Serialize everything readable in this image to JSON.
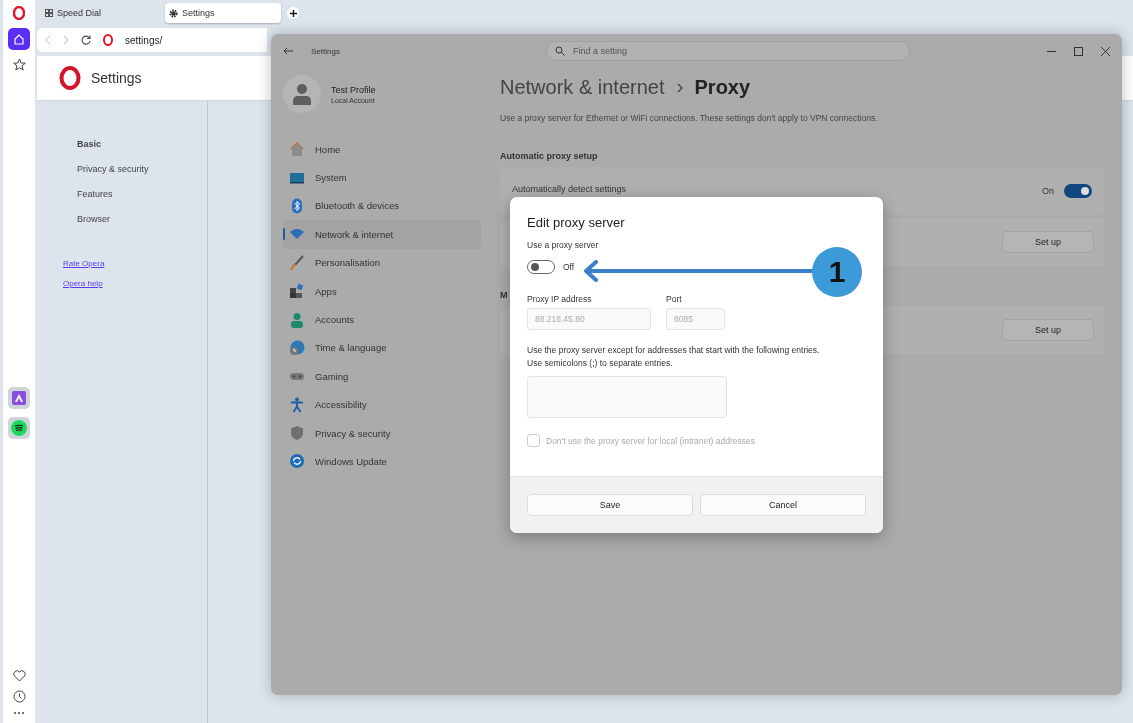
{
  "browser": {
    "tabs": [
      {
        "label": "Speed Dial",
        "selected": false
      },
      {
        "label": "Settings",
        "selected": true
      }
    ],
    "address": "settings/",
    "page_title": "Settings",
    "nav": [
      {
        "label": "Basic",
        "selected": true
      },
      {
        "label": "Privacy & security",
        "selected": false
      },
      {
        "label": "Features",
        "selected": false
      },
      {
        "label": "Browser",
        "selected": false
      }
    ],
    "links": [
      "Rate Opera",
      "Opera help"
    ]
  },
  "settings_window": {
    "title": "Settings",
    "search": {
      "placeholder": "Find a setting"
    },
    "profile": {
      "name": "Test Profile",
      "account": "Local Account"
    },
    "nav": [
      {
        "label": "Home",
        "selected": false
      },
      {
        "label": "System",
        "selected": false
      },
      {
        "label": "Bluetooth & devices",
        "selected": false
      },
      {
        "label": "Network & internet",
        "selected": true
      },
      {
        "label": "Personalisation",
        "selected": false
      },
      {
        "label": "Apps",
        "selected": false
      },
      {
        "label": "Accounts",
        "selected": false
      },
      {
        "label": "Time & language",
        "selected": false
      },
      {
        "label": "Gaming",
        "selected": false
      },
      {
        "label": "Accessibility",
        "selected": false
      },
      {
        "label": "Privacy & security",
        "selected": false
      },
      {
        "label": "Windows Update",
        "selected": false
      }
    ],
    "breadcrumb": [
      "Network & internet",
      "Proxy"
    ],
    "description": "Use a proxy server for Ethernet or WiFi connections. These settings don't apply to VPN connections.",
    "sections": [
      {
        "heading": "Automatic proxy setup",
        "rows": [
          {
            "kind": "toggle",
            "label": "Automatically detect settings",
            "state_label": "On",
            "on": true
          },
          {
            "kind": "button",
            "button": "Set up"
          }
        ]
      },
      {
        "heading": "M",
        "rows": [
          {
            "kind": "button",
            "button": "Set up"
          }
        ]
      }
    ]
  },
  "dialog": {
    "title": "Edit proxy server",
    "toggle_label": "Use a proxy server",
    "toggle": {
      "on": false,
      "state_label": "Off"
    },
    "fields": [
      {
        "label": "Proxy IP address",
        "value": "88.218.45.80",
        "disabled": true
      },
      {
        "label": "Port",
        "value": "8085",
        "disabled": true
      }
    ],
    "exceptions_help": [
      "Use the proxy server except for addresses that start with the following entries.",
      "Use semicolons (;) to separate entries."
    ],
    "local_checkbox": {
      "label": "Don't use the proxy server for local (intranet) addresses",
      "checked": false,
      "disabled": true
    },
    "buttons": [
      "Save",
      "Cancel"
    ]
  },
  "callout": {
    "number": "1"
  }
}
